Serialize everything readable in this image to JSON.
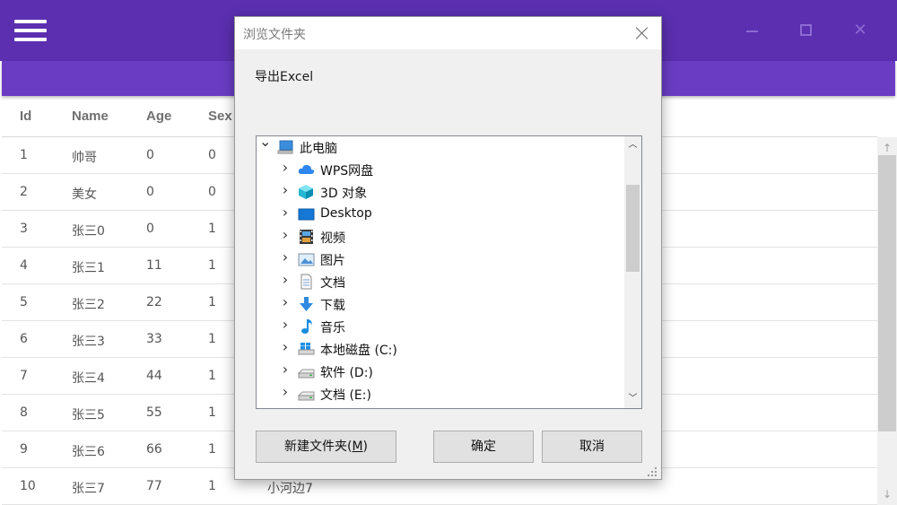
{
  "app": {
    "header_title": "",
    "colors": {
      "header": "#5b2fb0",
      "toolbar": "#6a3cc4"
    }
  },
  "grid": {
    "columns": [
      "Id",
      "Name",
      "Age",
      "Sex"
    ],
    "rows": [
      {
        "id": "1",
        "name": "帅哥",
        "age": "0",
        "sex": "0",
        "desc": ""
      },
      {
        "id": "2",
        "name": "美女",
        "age": "0",
        "sex": "0",
        "desc": ""
      },
      {
        "id": "3",
        "name": "张三0",
        "age": "0",
        "sex": "1",
        "desc": ""
      },
      {
        "id": "4",
        "name": "张三1",
        "age": "11",
        "sex": "1",
        "desc": ""
      },
      {
        "id": "5",
        "name": "张三2",
        "age": "22",
        "sex": "1",
        "desc": ""
      },
      {
        "id": "6",
        "name": "张三3",
        "age": "33",
        "sex": "1",
        "desc": ""
      },
      {
        "id": "7",
        "name": "张三4",
        "age": "44",
        "sex": "1",
        "desc": ""
      },
      {
        "id": "8",
        "name": "张三5",
        "age": "55",
        "sex": "1",
        "desc": ""
      },
      {
        "id": "9",
        "name": "张三6",
        "age": "66",
        "sex": "1",
        "desc": ""
      },
      {
        "id": "10",
        "name": "张三7",
        "age": "77",
        "sex": "1",
        "desc": "小河边7"
      }
    ]
  },
  "dialog": {
    "title": "浏览文件夹",
    "description": "导出Excel",
    "tree": [
      {
        "label": "此电脑",
        "icon": "computer-icon",
        "expanded": true,
        "level": 0
      },
      {
        "label": "WPS网盘",
        "icon": "cloud-icon",
        "level": 1
      },
      {
        "label": "3D 对象",
        "icon": "cube-3d-icon",
        "level": 1
      },
      {
        "label": "Desktop",
        "icon": "desktop-icon",
        "level": 1
      },
      {
        "label": "视频",
        "icon": "video-icon",
        "level": 1
      },
      {
        "label": "图片",
        "icon": "picture-icon",
        "level": 1
      },
      {
        "label": "文档",
        "icon": "document-icon",
        "level": 1
      },
      {
        "label": "下载",
        "icon": "download-icon",
        "level": 1
      },
      {
        "label": "音乐",
        "icon": "music-icon",
        "level": 1
      },
      {
        "label": "本地磁盘 (C:)",
        "icon": "windows-drive-icon",
        "level": 1
      },
      {
        "label": "软件 (D:)",
        "icon": "drive-icon",
        "level": 1
      },
      {
        "label": "文档 (E:)",
        "icon": "drive-icon",
        "level": 1
      }
    ],
    "buttons": {
      "new_folder": "新建文件夹(M)",
      "new_folder_mnemonic": "M",
      "ok": "确定",
      "cancel": "取消"
    }
  }
}
